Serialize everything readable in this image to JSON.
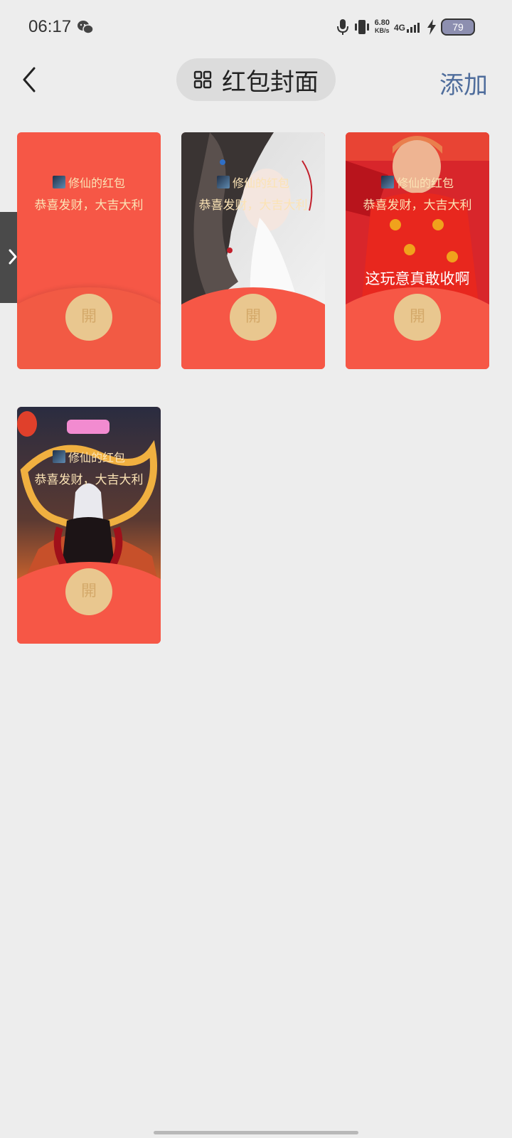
{
  "status_bar": {
    "time": "06:17",
    "net_speed_value": "6.80",
    "net_speed_unit": "KB/s",
    "signal": "4G",
    "battery": "79"
  },
  "header": {
    "title": "红包封面",
    "add_label": "添加"
  },
  "covers": [
    {
      "sender": "修仙的红包",
      "greeting": "恭喜发财，大吉大利",
      "open_label": "開",
      "caption": ""
    },
    {
      "sender": "修仙的红包",
      "greeting": "恭喜发财，大吉大利",
      "open_label": "開",
      "caption": ""
    },
    {
      "sender": "修仙的红包",
      "greeting": "恭喜发财，大吉大利",
      "open_label": "開",
      "caption": "这玩意真敢收啊"
    },
    {
      "sender": "修仙的红包",
      "greeting": "恭喜发财，大吉大利",
      "open_label": "開",
      "caption": ""
    }
  ],
  "colors": {
    "envelope_red": "#f65746",
    "gold_text": "#fbe3b5",
    "open_button": "#e9c78f",
    "accent_link": "#4f6d9c"
  }
}
